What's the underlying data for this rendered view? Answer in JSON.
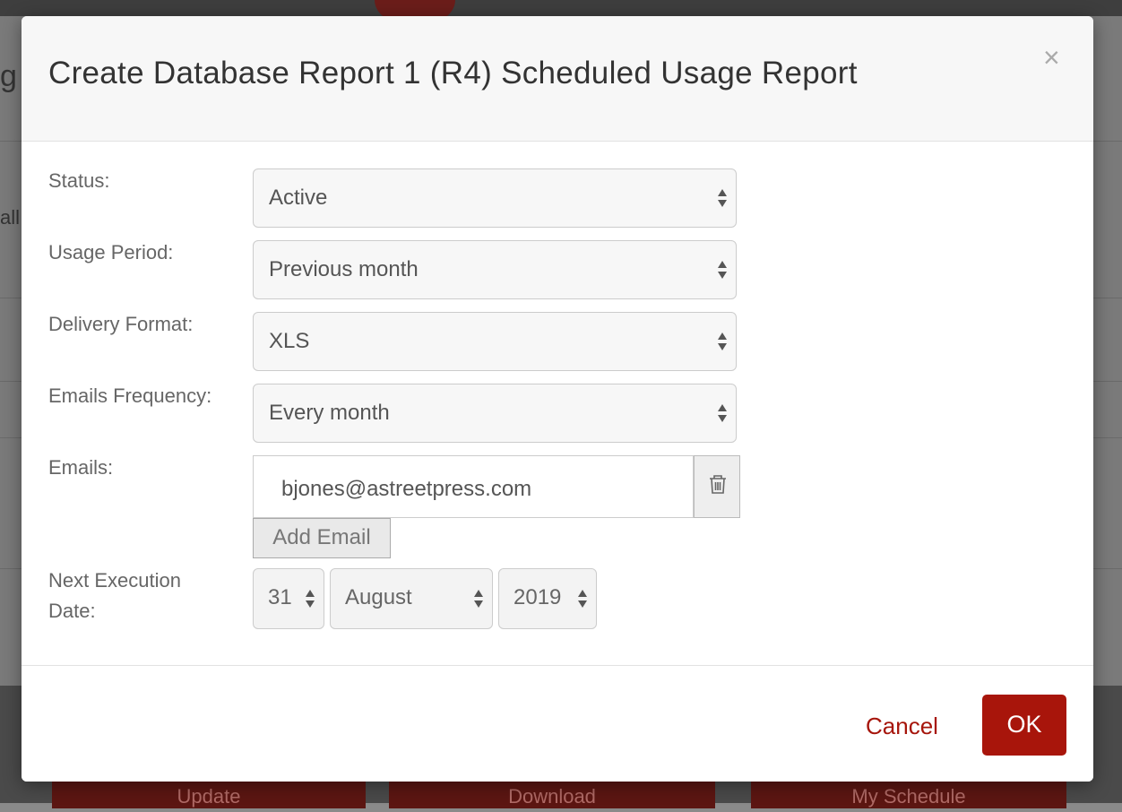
{
  "background": {
    "partial_left_text": "g",
    "partial_left_text2": "all",
    "buttons": [
      "Update",
      "Download",
      "My Schedule"
    ]
  },
  "modal": {
    "title": "Create Database Report 1 (R4) Scheduled Usage Report",
    "close_glyph": "×",
    "fields": {
      "status": {
        "label": "Status:",
        "value": "Active"
      },
      "usage_period": {
        "label": "Usage Period:",
        "value": "Previous month"
      },
      "delivery_format": {
        "label": "Delivery Format:",
        "value": "XLS"
      },
      "emails_frequency": {
        "label": "Emails Frequency:",
        "value": "Every month"
      },
      "emails": {
        "label": "Emails:",
        "value": "bjones@astreetpress.com",
        "add_label": "Add Email",
        "remove_icon": "trash-icon"
      },
      "next_execution_date": {
        "label_line1": "Next Execution",
        "label_line2": "Date:",
        "day": "31",
        "month": "August",
        "year": "2019"
      }
    },
    "footer": {
      "cancel_label": "Cancel",
      "ok_label": "OK"
    },
    "colors": {
      "accent": "#a8150b"
    }
  }
}
